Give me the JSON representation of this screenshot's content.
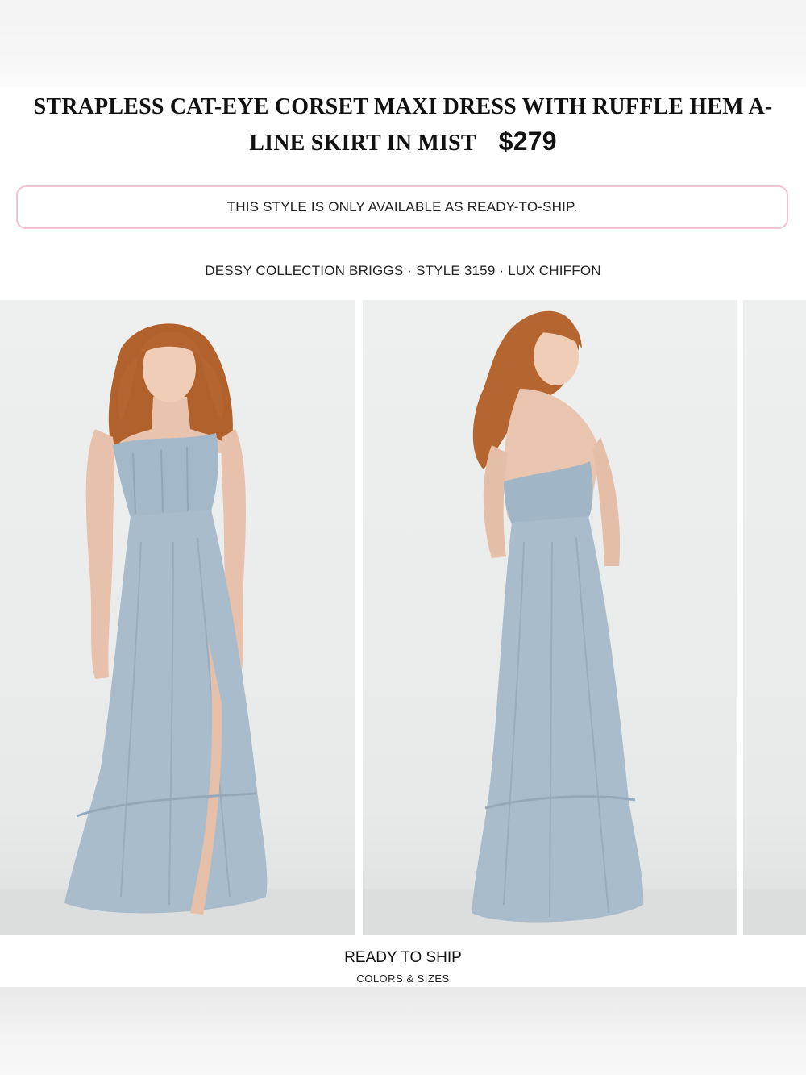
{
  "product": {
    "title_line1": "STRAPLESS CAT-EYE CORSET MAXI DRESS WITH RUFFLE HEM A-",
    "title_line2": "LINE SKIRT IN MIST",
    "price": "$279"
  },
  "notice": {
    "text": "THIS STYLE IS ONLY AVAILABLE AS READY-TO-SHIP."
  },
  "collection": {
    "text": "DESSY COLLECTION BRIGGS · STYLE 3159 · LUX CHIFFON"
  },
  "gallery": {
    "photos": [
      {
        "view": "front"
      },
      {
        "view": "back"
      },
      {
        "view": "partial"
      }
    ]
  },
  "shipping": {
    "title": "READY TO SHIP",
    "subtitle": "COLORS & SIZES"
  },
  "colors": {
    "dress": "#a9bccb",
    "hair": "#b5652f",
    "notice_border": "#f0c4d0"
  }
}
